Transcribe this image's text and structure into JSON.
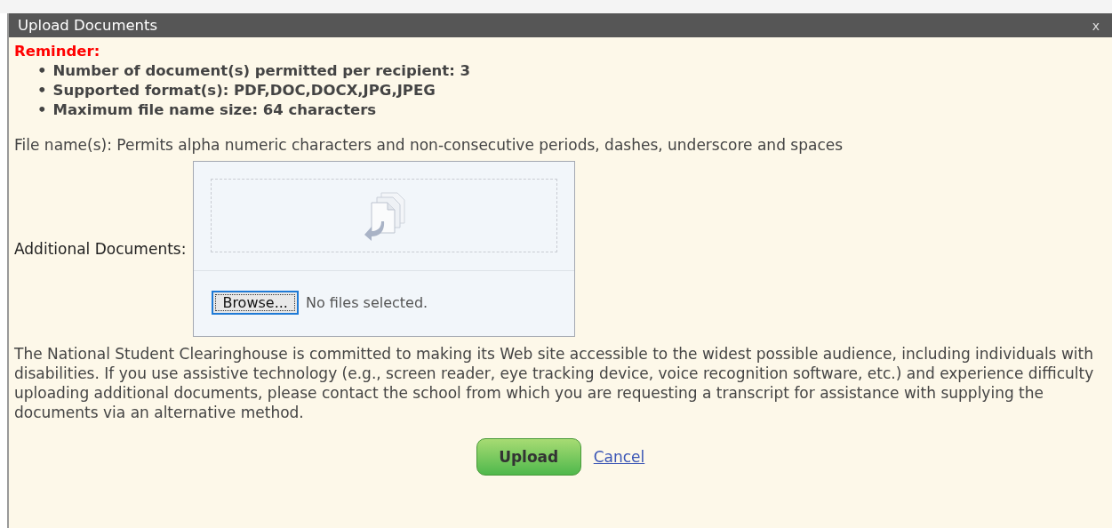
{
  "dialog": {
    "title": "Upload Documents",
    "close": "x"
  },
  "reminder": {
    "heading": "Reminder:",
    "bullet": "•",
    "items": [
      "Number of document(s) permitted per recipient: 3",
      "Supported format(s): PDF,DOC,DOCX,JPG,JPEG",
      "Maximum file name size: 64 characters"
    ]
  },
  "file_name_note": "File name(s): Permits alpha numeric characters and non-consecutive periods, dashes, underscore and spaces",
  "upload": {
    "label": "Additional Documents:",
    "browse_button": "Browse...",
    "status": "No files selected."
  },
  "accessibility_note": "The National Student Clearinghouse is committed to making its Web site accessible to the widest possible audience, including individuals with disabilities. If you use assistive technology (e.g., screen reader, eye tracking device, voice recognition software, etc.) and experience difficulty uploading additional documents, please contact the school from which you are requesting a transcript for assistance with supplying the documents via an alternative method.",
  "actions": {
    "upload_button": "Upload",
    "cancel_link": "Cancel"
  }
}
